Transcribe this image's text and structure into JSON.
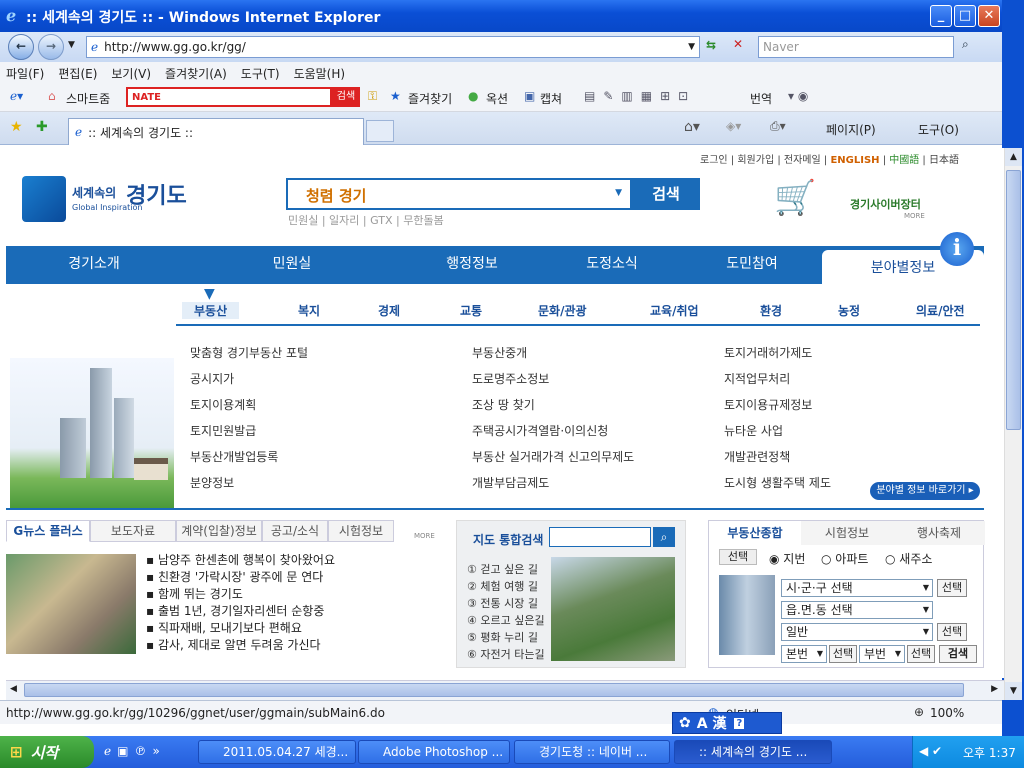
{
  "window": {
    "title": ":: 세계속의 경기도 :: - Windows Internet Explorer"
  },
  "address": {
    "url": "http://www.gg.go.kr/gg/",
    "search_placeholder": "Naver"
  },
  "menu": [
    "파일(F)",
    "편집(E)",
    "보기(V)",
    "즐겨찾기(A)",
    "도구(T)",
    "도움말(H)"
  ],
  "links": {
    "smart": "스마트줌",
    "nate": "NATE",
    "search_btn": "검색",
    "fav": "즐겨찾기",
    "option": "옥션",
    "capture": "캡쳐",
    "translate": "번역"
  },
  "tab": {
    "label": ":: 세계속의 경기도 ::"
  },
  "tab_tools": [
    "페이지(P)",
    "도구(O)"
  ],
  "site": {
    "util": [
      "로그인",
      "회원가입",
      "전자메일",
      "ENGLISH",
      "中國語",
      "日本語"
    ],
    "logo_small": "세계속의",
    "logo_big": "경기도",
    "logo_sub": "Global Inspiration",
    "search_value": "청렴 경기",
    "search_btn": "검색",
    "search_tags": "민원실 | 일자리 | GTX | 무한돌봄",
    "cyber": "경기사이버장터",
    "more": "MORE",
    "nav": [
      "경기소개",
      "민원실",
      "행정정보",
      "도정소식",
      "도민참여",
      "분야별정보"
    ],
    "subnav": [
      "부동산",
      "복지",
      "경제",
      "교통",
      "문화/관광",
      "교육/취업",
      "환경",
      "농정",
      "의료/안전"
    ],
    "col1": [
      "맞춤형 경기부동산 포털",
      "공시지가",
      "토지이용계획",
      "토지민원발급",
      "부동산개발업등록",
      "분양정보"
    ],
    "col2": [
      "부동산중개",
      "도로명주소정보",
      "조상 땅 찾기",
      "주택공시가격열람·이의신청",
      "부동산 실거래가격 신고의무제도",
      "개발부담금제도"
    ],
    "col3": [
      "토지거래허가제도",
      "지적업무처리",
      "토지이용규제정보",
      "뉴타운 사업",
      "개발관련정책",
      "도시형 생활주택 제도"
    ],
    "shortcut": "분야별 정보 바로가기",
    "news_tabs": [
      "G뉴스 플러스",
      "보도자료",
      "계약(입찰)정보",
      "공고/소식",
      "시험정보"
    ],
    "news": [
      "남양주 한센촌에 행복이 찾아왔어요",
      "친환경 '가락시장' 광주에 문 연다",
      "함께 뛰는 경기도",
      "출범 1년, 경기일자리센터 순항중",
      "직파재배, 모내기보다 편해요",
      "감사, 제대로 알면 두려움 가신다"
    ],
    "map_title": "지도 통합검색",
    "map_list": [
      "① 걷고 싶은 길",
      "② 체험 여행 길",
      "③ 전통 시장 길",
      "④ 오르고 싶은길",
      "⑤ 평화 누리 길",
      "⑥ 자전거 타는길"
    ],
    "re_tabs": [
      "부동산종합",
      "시험정보",
      "행사축제"
    ],
    "re_choice": "선택",
    "re_radios": [
      "지번",
      "아파트",
      "새주소"
    ],
    "re_selects": [
      "시·군·구 선택",
      "읍.면.동 선택",
      "일반"
    ],
    "re_btn": "선택",
    "re_main": "본번",
    "re_sub": "부번",
    "re_search": "검색"
  },
  "status": {
    "url": "http://www.gg.go.kr/gg/10296/ggnet/user/ggmain/subMain6.do",
    "zone": "인터넷",
    "zoom": "100%"
  },
  "ime": "A 漢",
  "taskbar": {
    "start": "시작",
    "tasks": [
      "2011.05.04.27 세경...",
      "Adobe Photoshop ...",
      "경기도청 :: 네이버 ...",
      ":: 세계속의 경기도 ..."
    ],
    "clock": "오후 1:37"
  }
}
